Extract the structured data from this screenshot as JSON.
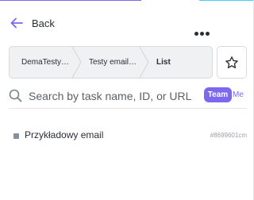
{
  "colors": {
    "accent": "#7b68ee",
    "top_strip_left": "#7b68ee",
    "top_strip_right": "#49ccf9",
    "status_dot": "#87909e"
  },
  "header": {
    "back_label": "Back",
    "back_icon": "arrow-left-icon",
    "more_icon": "more-horizontal-icon"
  },
  "breadcrumb": {
    "items": [
      "DemaTesty…",
      "Testy email…",
      "List"
    ],
    "star_icon": "star-icon"
  },
  "search": {
    "placeholder": "Search by task name, ID, or URL",
    "value": "",
    "icon": "search-icon",
    "team_label": "Team",
    "me_label": "Me"
  },
  "tasks": [
    {
      "name": "Przykładowy email",
      "id": "#8699601cm"
    }
  ]
}
